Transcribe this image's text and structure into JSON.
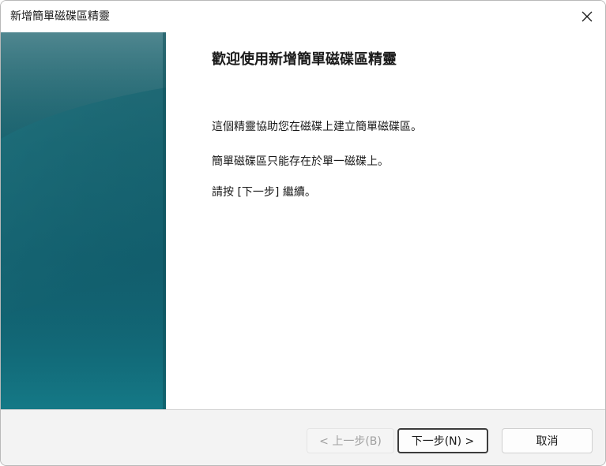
{
  "window": {
    "title": "新增簡單磁碟區精靈"
  },
  "icons": {
    "close": "close-icon"
  },
  "content": {
    "heading": "歡迎使用新增簡單磁碟區精靈",
    "paragraphs": [
      "這個精靈協助您在磁碟上建立簡單磁碟區。",
      "簡單磁碟區只能存在於單一磁碟上。",
      "請按 [下一步] 繼續。"
    ]
  },
  "buttons": {
    "back": "< 上一步(B)",
    "next": "下一步(N) >",
    "cancel": "取消"
  },
  "colors": {
    "side_panel": "#135e6d",
    "footer": "#f3f3f3"
  }
}
